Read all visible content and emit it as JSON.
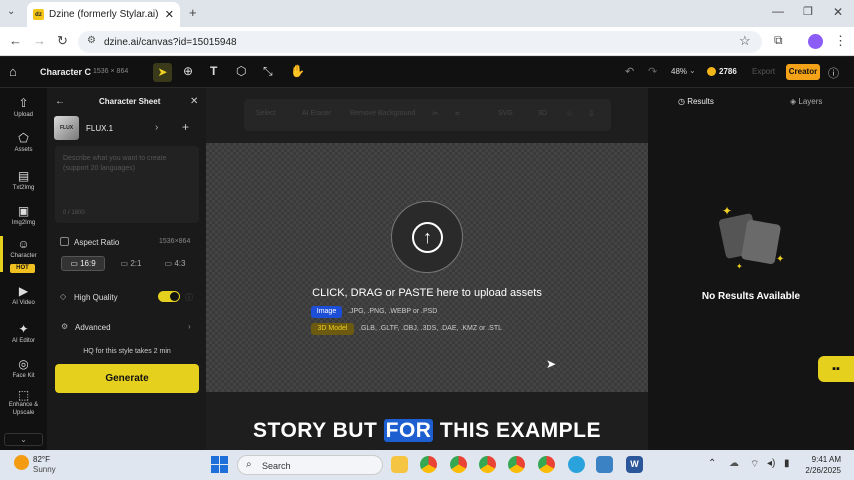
{
  "browser": {
    "tab_title": "Dzine (formerly Stylar.ai) - The",
    "tab_favicon": "dz",
    "url": "dzine.ai/canvas?id=15015948"
  },
  "app": {
    "project_name": "Character C",
    "canvas_size": "1536 × 864",
    "zoom": "48%",
    "credits": "2786",
    "export_label": "Export",
    "creator_label": "Creator"
  },
  "rail": {
    "upload": "Upload",
    "assets": "Assets",
    "txt2img": "Txt2Img",
    "img2img": "Img2Img",
    "character": "Character",
    "hot": "HOT",
    "ai_video": "AI Video",
    "ai_editor": "AI Editor",
    "face_kit": "Face Kit",
    "enhance": "Enhance & Upscale"
  },
  "panel": {
    "title": "Character Sheet",
    "model": "FLUX.1",
    "prompt_placeholder": "Describe what you want to create (support 20 languages)",
    "char_count": "0 / 1800",
    "aspect_label": "Aspect Ratio",
    "aspect_value": "1536×864",
    "ratios": [
      "16:9",
      "2:1",
      "4:3"
    ],
    "hq_label": "High Quality",
    "advanced_label": "Advanced",
    "hq_note": "HQ for this style takes 2 min",
    "generate_label": "Generate"
  },
  "toolbar": {
    "select": "Select",
    "ai_eraser": "AI Eraser",
    "remove_bg": "Remove Background",
    "svg": "SVG",
    "three_d": "3D"
  },
  "upload": {
    "main_text": "CLICK, DRAG or PASTE here to upload assets",
    "image_badge": "Image",
    "image_formats": ".JPG, .PNG, .WEBP or .PSD",
    "model_badge": "3D Model",
    "model_formats": ".GLB, .GLTF, .OBJ, .3DS, .DAE, .KMZ or .STL"
  },
  "subtitle": {
    "before": "STORY BUT",
    "highlight": "FOR",
    "after": "THIS EXAMPLE"
  },
  "right": {
    "results_tab": "Results",
    "layers_tab": "Layers",
    "empty_text": "No Results Available"
  },
  "taskbar": {
    "temp": "82°F",
    "weather": "Sunny",
    "search": "Search",
    "time": "9:41 AM",
    "date": "2/26/2025"
  },
  "colors": {
    "accent_yellow": "#e6d01e",
    "creator_orange": "#f4a318",
    "badge_blue": "#1d4ed8"
  }
}
